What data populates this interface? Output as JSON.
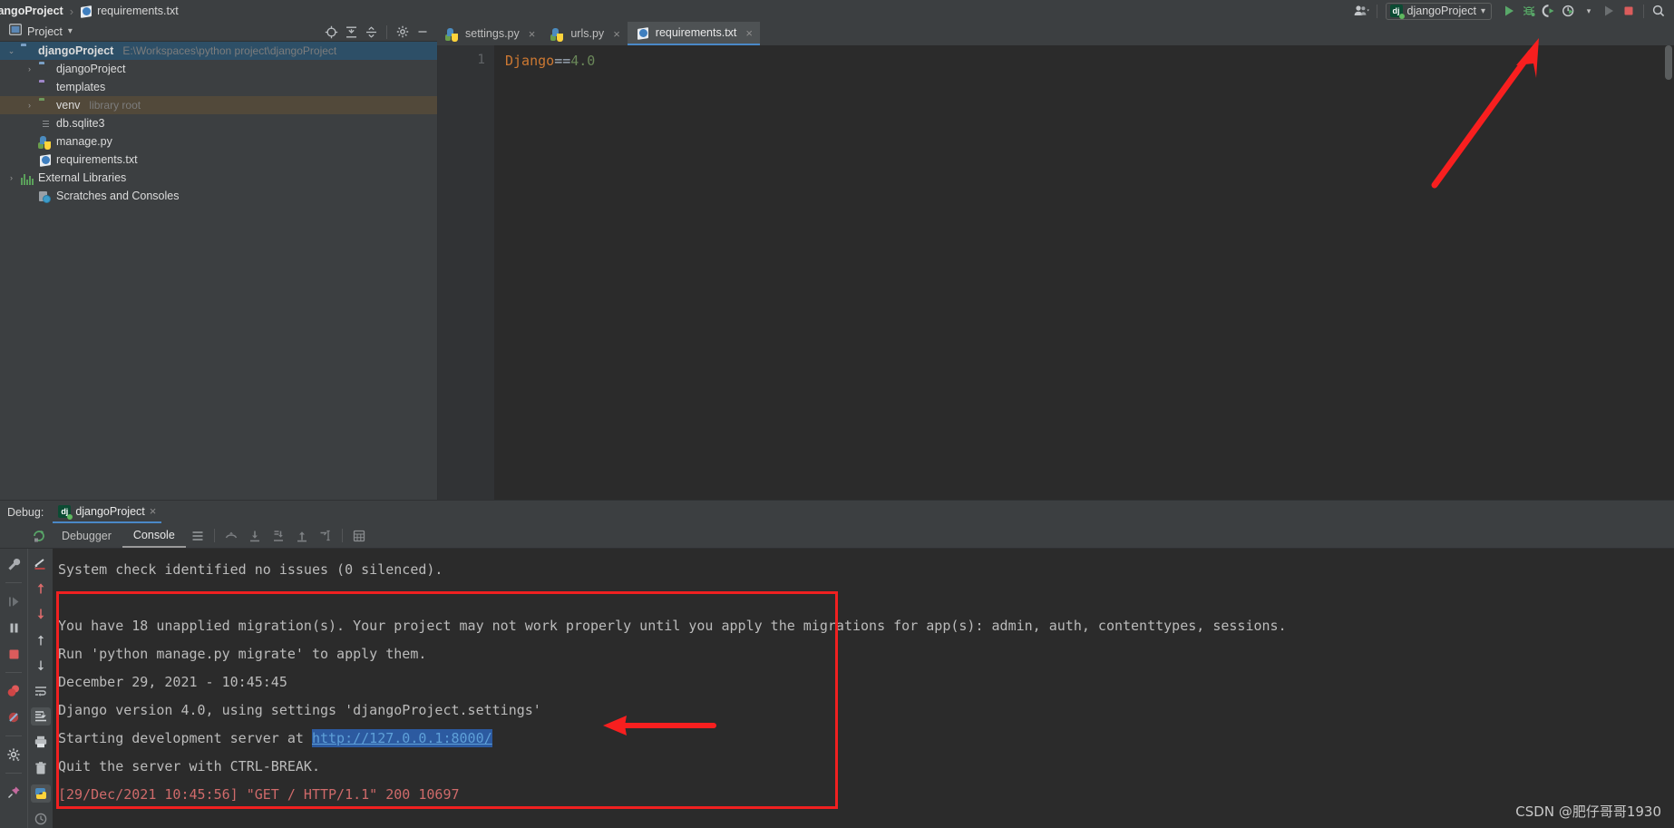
{
  "breadcrumb": {
    "project": "jangoProject",
    "separator": "›",
    "file": "requirements.txt"
  },
  "top_toolbar": {
    "profile_icon": "user-group-icon",
    "run_config_name": "djangoProject",
    "run_config_icon": "django-icon",
    "dropdown_caret": "▾",
    "buttons": [
      {
        "name": "run-button",
        "icon": "play-icon",
        "label": "Run"
      },
      {
        "name": "debug-button",
        "icon": "bug-icon",
        "label": "Debug"
      },
      {
        "name": "run-with-coverage-button",
        "icon": "coverage-icon",
        "label": "Run with Coverage"
      },
      {
        "name": "profile-button",
        "icon": "profile-icon",
        "label": "Profile"
      },
      {
        "name": "attach-button",
        "icon": "play-muted-icon",
        "label": "Attach to Process"
      },
      {
        "name": "stop-button",
        "icon": "stop-square-icon",
        "label": "Stop"
      },
      {
        "name": "search-everywhere-button",
        "icon": "search-icon",
        "label": "Search Everywhere"
      }
    ]
  },
  "project_panel": {
    "title": "Project",
    "title_caret": "▾",
    "window_icon": "project-window-icon",
    "actions": [
      {
        "name": "select-opened-file-button",
        "icon": "crosshair-icon"
      },
      {
        "name": "expand-all-button",
        "icon": "expand-all-icon"
      },
      {
        "name": "collapse-all-button",
        "icon": "collapse-all-icon"
      },
      {
        "name": "settings-button",
        "icon": "gear-icon"
      },
      {
        "name": "hide-button",
        "icon": "minimize-icon"
      }
    ],
    "tree": [
      {
        "label": "djangoProject",
        "note": "E:\\Workspaces\\python project\\djangoProject",
        "icon": "folder-blue",
        "arrow": "⌄",
        "indent": 1,
        "bold": true,
        "state": "selected"
      },
      {
        "label": "djangoProject",
        "note": "",
        "icon": "folder-source",
        "arrow": "›",
        "indent": 2,
        "bold": false,
        "state": ""
      },
      {
        "label": "templates",
        "note": "",
        "icon": "folder-purple",
        "arrow": "",
        "indent": 3,
        "bold": false,
        "state": ""
      },
      {
        "label": "venv",
        "note": "library root",
        "icon": "folder-green",
        "arrow": "›",
        "indent": 2,
        "bold": false,
        "state": "highlight"
      },
      {
        "label": "db.sqlite3",
        "note": "",
        "icon": "file-sqlite",
        "arrow": "",
        "indent": 3,
        "bold": false,
        "state": ""
      },
      {
        "label": "manage.py",
        "note": "",
        "icon": "file-python",
        "arrow": "",
        "indent": 3,
        "bold": false,
        "state": ""
      },
      {
        "label": "requirements.txt",
        "note": "",
        "icon": "file-requirements",
        "arrow": "",
        "indent": 3,
        "bold": false,
        "state": ""
      },
      {
        "label": "External Libraries",
        "note": "",
        "icon": "libraries-icon",
        "arrow": "›",
        "indent": 1,
        "bold": false,
        "state": ""
      },
      {
        "label": "Scratches and Consoles",
        "note": "",
        "icon": "scratches-icon",
        "arrow": "",
        "indent": 2,
        "bold": false,
        "state": ""
      }
    ]
  },
  "editor": {
    "tabs": [
      {
        "label": "settings.py",
        "icon": "python-file-icon",
        "active": false,
        "close": "×"
      },
      {
        "label": "urls.py",
        "icon": "python-file-icon",
        "active": false,
        "close": "×"
      },
      {
        "label": "requirements.txt",
        "icon": "requirements-file-icon",
        "active": true,
        "close": "×"
      }
    ],
    "line_numbers": [
      "1"
    ],
    "code": {
      "package": "Django",
      "operator": "==",
      "version": "4.0"
    }
  },
  "debug_panel": {
    "label": "Debug:",
    "session_name": "djangoProject",
    "session_icon": "django-icon",
    "session_close": "×",
    "rerun_icon": "rerun-icon",
    "tabs": [
      {
        "label": "Debugger",
        "active": false
      },
      {
        "label": "Console",
        "active": true
      }
    ],
    "toolbar_buttons": [
      {
        "name": "layout-settings-button",
        "icon": "menu-lines-icon"
      },
      {
        "name": "show-execution-point-button",
        "icon": "arc-arrow-icon"
      },
      {
        "name": "step-over-button",
        "icon": "step-over-icon"
      },
      {
        "name": "step-into-button",
        "icon": "step-into-icon"
      },
      {
        "name": "step-out-button",
        "icon": "step-out-icon"
      },
      {
        "name": "run-to-cursor-button",
        "icon": "run-to-cursor-icon"
      },
      {
        "name": "evaluate-expression-button",
        "icon": "calculator-icon"
      }
    ],
    "left_toolbar_primary": [
      {
        "name": "settings-wrench-button",
        "icon": "wrench-icon"
      },
      {
        "name": "resume-program-button",
        "icon": "resume-icon"
      },
      {
        "name": "pause-program-button",
        "icon": "pause-icon"
      },
      {
        "name": "stop-session-button",
        "icon": "stop-square-icon"
      },
      {
        "name": "view-breakpoints-button",
        "icon": "breakpoints-icon"
      },
      {
        "name": "mute-breakpoints-button",
        "icon": "mute-breakpoints-icon"
      },
      {
        "name": "settings-gear-button",
        "icon": "gear-icon"
      },
      {
        "name": "pin-tab-button",
        "icon": "pin-icon"
      }
    ],
    "left_toolbar_secondary": [
      {
        "name": "soft-wrap-button",
        "icon": "soft-wrap-icon"
      },
      {
        "name": "previous-occurrence-button",
        "icon": "arrow-up-red-icon"
      },
      {
        "name": "next-occurrence-button",
        "icon": "arrow-down-red-icon"
      },
      {
        "name": "up-the-stack-button",
        "icon": "arrow-up-icon"
      },
      {
        "name": "down-the-stack-button",
        "icon": "arrow-down-icon"
      },
      {
        "name": "use-soft-wraps-button",
        "icon": "wrap-lines-icon"
      },
      {
        "name": "scroll-to-end-button",
        "icon": "scroll-end-icon"
      },
      {
        "name": "print-button",
        "icon": "printer-icon"
      },
      {
        "name": "clear-all-button",
        "icon": "trash-icon"
      },
      {
        "name": "python-console-button",
        "icon": "python-console-icon"
      },
      {
        "name": "history-button",
        "icon": "clock-icon"
      }
    ],
    "console_lines": [
      {
        "text": "System check identified no issues (0 silenced).",
        "color": "normal"
      },
      {
        "text": "",
        "color": "normal"
      },
      {
        "text": "You have 18 unapplied migration(s). Your project may not work properly until you apply the migrations for app(s): admin, auth, contenttypes, sessions.",
        "color": "normal"
      },
      {
        "text": "Run 'python manage.py migrate' to apply them.",
        "color": "normal"
      },
      {
        "text": "December 29, 2021 - 10:45:45",
        "color": "normal"
      },
      {
        "text": "Django version 4.0, using settings 'djangoProject.settings'",
        "color": "normal"
      },
      {
        "text": "Starting development server at ",
        "color": "normal",
        "link": "http://127.0.0.1:8000/"
      },
      {
        "text": "Quit the server with CTRL-BREAK.",
        "color": "normal"
      },
      {
        "text": "[29/Dec/2021 10:45:56] \"GET / HTTP/1.1\" 200 10697",
        "color": "red"
      }
    ]
  },
  "annotations": {
    "highlight_color": "#f02020",
    "arrow_to_debug_button": "arrow-pointing-to-debug-button",
    "arrow_to_url": "arrow-pointing-to-server-url",
    "box_around_console_output": "red-rectangle-highlight"
  },
  "watermark": {
    "text": "CSDN @肥仔哥哥1930"
  },
  "colors": {
    "background": "#3c3f41",
    "editor_background": "#2b2b2b",
    "selection_blue": "#2d4f67",
    "accent_blue": "#4a88c7",
    "annotation_red": "#f02020",
    "string_green": "#6a8759",
    "keyword_orange": "#cc7832"
  }
}
